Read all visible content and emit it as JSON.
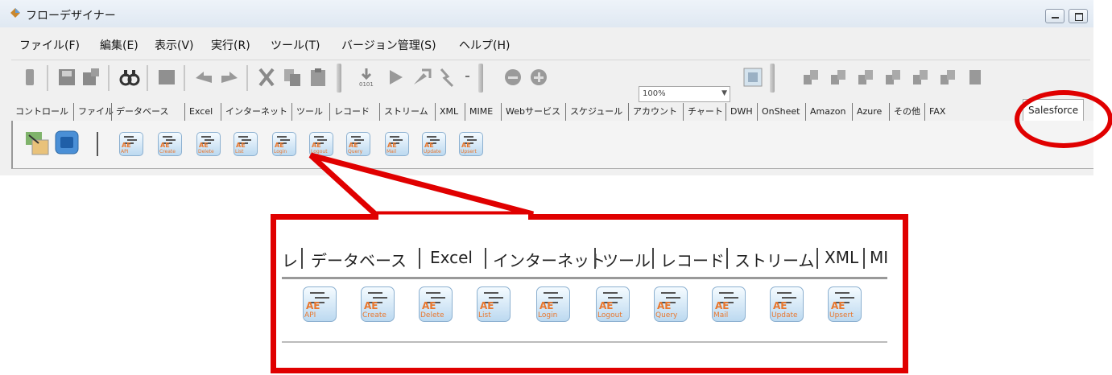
{
  "window": {
    "title": "フローデザイナー"
  },
  "menu": [
    "ファイル(F)",
    "編集(E)",
    "表示(V)",
    "実行(R)",
    "ツール(T)",
    "バージョン管理(S)",
    "ヘルプ(H)"
  ],
  "toolbar": {
    "zoom_value": "100%"
  },
  "tabs": [
    "コントロール",
    "ファイル",
    "データベース",
    "Excel",
    "インターネット",
    "ツール",
    "レコード",
    "ストリーム",
    "XML",
    "MIME",
    "Webサービス",
    "スケジュール",
    "アカウント",
    "チャート",
    "DWH",
    "OnSheet",
    "Amazon",
    "Azure",
    "その他",
    "FAX",
    "Salesforce"
  ],
  "active_tab": "Salesforce",
  "salesforce_icons": [
    "API",
    "Create",
    "Delete",
    "List",
    "Login",
    "Logout",
    "Query",
    "Mail",
    "Update",
    "Upsert"
  ],
  "icon_prefix": "AE",
  "callout": {
    "tabs": [
      "レ",
      "データベース",
      "Excel",
      "インターネット",
      "ツール",
      "レコード",
      "ストリーム",
      "XML",
      "MI"
    ]
  },
  "colors": {
    "highlight": "#e00000",
    "icon_label": "#e8772e"
  }
}
